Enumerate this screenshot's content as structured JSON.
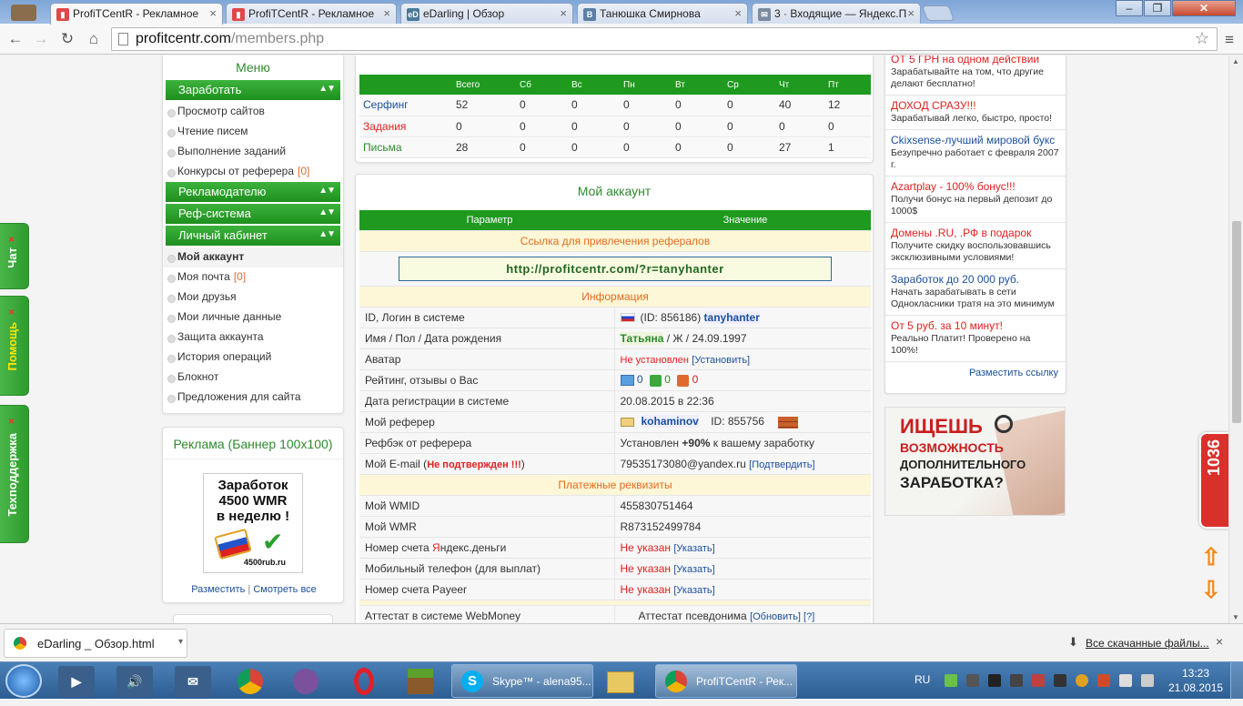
{
  "browser": {
    "tabs": [
      {
        "title": "ProfiTCentR - Рекламное",
        "active": true
      },
      {
        "title": "ProfiTCentR - Рекламное",
        "active": false
      },
      {
        "title": "eDarling | Обзор",
        "active": false
      },
      {
        "title": "Танюшка Смирнова",
        "active": false
      },
      {
        "title": "3 · Входящие — Яндекс.П",
        "active": false
      }
    ],
    "url_host": "profitcentr.com",
    "url_path": "/members.php"
  },
  "side_tabs": [
    "Чат",
    "Помощь",
    "Техподдержка"
  ],
  "menu": {
    "title": "Меню",
    "sections": [
      {
        "label": "Заработать",
        "items": [
          {
            "label": "Просмотр сайтов",
            "count": ""
          },
          {
            "label": "Чтение писем",
            "count": ""
          },
          {
            "label": "Выполнение заданий",
            "count": ""
          },
          {
            "label": "Конкурсы от реферера",
            "count": "[0]"
          }
        ]
      },
      {
        "label": "Рекламодателю",
        "items": []
      },
      {
        "label": "Реф-система",
        "items": []
      },
      {
        "label": "Личный кабинет",
        "items": [
          {
            "label": "Мой аккаунт",
            "count": ""
          },
          {
            "label": "Моя почта",
            "count": "[0]"
          },
          {
            "label": "Мои друзья",
            "count": ""
          },
          {
            "label": "Мои личные данные",
            "count": ""
          },
          {
            "label": "Защита аккаунта",
            "count": ""
          },
          {
            "label": "История операций",
            "count": ""
          },
          {
            "label": "Блокнот",
            "count": ""
          },
          {
            "label": "Предложения для сайта",
            "count": ""
          }
        ]
      }
    ]
  },
  "banner": {
    "title": "Реклама (Баннер 100x100)",
    "line1": "Заработок",
    "line2": "4500 WMR",
    "line3": "в неделю !",
    "site": "4500rub.ru",
    "place": "Разместить",
    "sep": "|",
    "view_all": "Смотреть все"
  },
  "stats": {
    "headers": [
      "",
      "Всего",
      "Сб",
      "Вс",
      "Пн",
      "Вт",
      "Ср",
      "Чт",
      "Пт"
    ],
    "rows": [
      {
        "label": "Серфинг",
        "values": [
          "52",
          "0",
          "0",
          "0",
          "0",
          "0",
          "40",
          "12"
        ]
      },
      {
        "label": "Задания",
        "values": [
          "0",
          "0",
          "0",
          "0",
          "0",
          "0",
          "0",
          "0"
        ]
      },
      {
        "label": "Письма",
        "values": [
          "28",
          "0",
          "0",
          "0",
          "0",
          "0",
          "27",
          "1"
        ]
      }
    ]
  },
  "account": {
    "title": "Мой аккаунт",
    "col_param": "Параметр",
    "col_value": "Значение",
    "ref_section": "Ссылка для привлечения рефералов",
    "ref_link": "http://profitcentr.com/?r=tanyhanter",
    "info_section": "Информация",
    "login_label": "ID, Логин в системе",
    "login_id": "(ID: 856186)",
    "login_name": "tanyhanter",
    "name_label": "Имя / Пол / Дата рождения",
    "name_value": "Татьяна",
    "name_rest": " / Ж / 24.09.1997",
    "avatar_label": "Аватар",
    "avatar_value": "Не установлен",
    "avatar_link": "[Установить]",
    "rating_label": "Рейтинг, отзывы о Вас",
    "rating_values": [
      "0",
      "0",
      "0"
    ],
    "reg_label": "Дата регистрации в системе",
    "reg_value": "20.08.2015 в 22:36",
    "referrer_label": "Мой реферер",
    "referrer_name": "kohaminov",
    "referrer_id": "ID: 855756",
    "refback_label": "Рефбэк от реферера",
    "refback_pre": "Установлен ",
    "refback_pct": "+90%",
    "refback_post": " к вашему заработку",
    "email_label": "Мой E-mail",
    "email_note": "Не подтвержден !!!",
    "email_value": "79535173080@yandex.ru",
    "email_link": "[Подтвердить]",
    "pay_section": "Платежные реквизиты",
    "wmid_label": "Мой WMID",
    "wmid_value": "455830751464",
    "wmr_label": "Мой WMR",
    "wmr_value": "R873152499784",
    "yandex_label_pre": "Номер счета ",
    "yandex_label_y": "Я",
    "yandex_label_post": "ндекс.деньги",
    "phone_label": "Мобильный телефон (для выплат)",
    "payeer_label": "Номер счета Payeer",
    "not_set": "Не указан",
    "set_link": "[Указать]",
    "attestat_label": "Аттестат в системе WebMoney",
    "attestat_value": "Аттестат псевдонима",
    "attestat_link": "[Обновить] [?]"
  },
  "ads": [
    {
      "title": "ОТ 5 ГРН на одном действии",
      "desc": "Зарабатывайте на том, что другие делают бесплатно!",
      "color": "red"
    },
    {
      "title": "ДОХОД СРАЗУ!!!",
      "desc": "Зарабатывай легко, быстро, просто!",
      "color": "red"
    },
    {
      "title": "Ckixsense-лучший мировой букс",
      "desc": "Безупречно работает с февраля 2007 г.",
      "color": "blue"
    },
    {
      "title": "Azartplay - 100% бонус!!!",
      "desc": "Получи бонус на первый депозит до 1000$",
      "color": "red"
    },
    {
      "title": "Домены .RU, .РФ в подарок",
      "desc": "Получите скидку воспользовавшись эксклюзивными условиями!",
      "color": "red"
    },
    {
      "title": "Заработок до 20 000 руб.",
      "desc": "Начать зарабатывать в сети Однокласники тратя на это минимум",
      "color": "blue"
    },
    {
      "title": "От 5 руб. за 10 минут!",
      "desc": "Реально Платит! Проверено на 100%!",
      "color": "red"
    }
  ],
  "ads_place": "Разместить ссылку",
  "promo": {
    "line1": "ИЩЕШЬ",
    "line2": "ВОЗМОЖНОСТЬ",
    "line3": "ДОПОЛНИТЕЛЬНОГО",
    "line4": "ЗАРАБОТКА?"
  },
  "counter_badge": "1036",
  "download": {
    "file": "eDarling _ Обзор.html",
    "all": "Все скачанные файлы..."
  },
  "taskbar": {
    "tasks": [
      {
        "label": "Skype™ - alena95..."
      },
      {
        "label": "ProfiTCentR - Рек..."
      }
    ],
    "lang": "RU",
    "time": "13:23",
    "date": "21.08.2015"
  },
  "colors": {
    "green": "#1f9a1f",
    "red": "#e02020",
    "link": "#1b4f9c",
    "section_bg": "#fdf7d7"
  }
}
